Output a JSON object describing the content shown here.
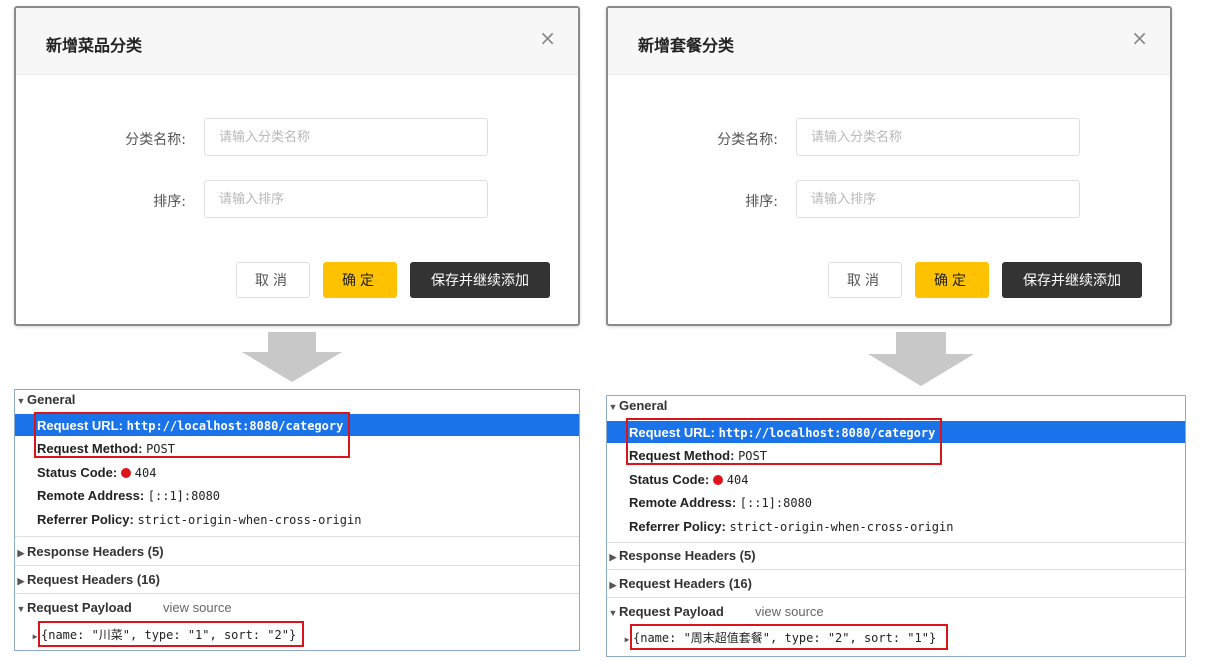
{
  "left": {
    "dialog": {
      "title": "新增菜品分类",
      "close_glyph": "×",
      "name_label": "分类名称:",
      "name_placeholder": "请输入分类名称",
      "sort_label": "排序:",
      "sort_placeholder": "请输入排序",
      "cancel_label": "取消",
      "ok_label": "确定",
      "save_label": "保存并继续添加"
    },
    "devtools": {
      "general_title": "General",
      "request_url_key": "Request URL:",
      "request_url_value": "http://localhost:8080/category",
      "request_method_key": "Request Method:",
      "request_method_value": "POST",
      "status_code_key": "Status Code:",
      "status_code_value": "404",
      "remote_address_key": "Remote Address:",
      "remote_address_value": "[::1]:8080",
      "referrer_policy_key": "Referrer Policy:",
      "referrer_policy_value": "strict-origin-when-cross-origin",
      "response_headers": "Response Headers (5)",
      "request_headers": "Request Headers (16)",
      "request_payload": "Request Payload",
      "view_source": "view source",
      "payload_value": "{name: \"川菜\", type: \"1\", sort: \"2\"}"
    }
  },
  "right": {
    "dialog": {
      "title": "新增套餐分类",
      "close_glyph": "×",
      "name_label": "分类名称:",
      "name_placeholder": "请输入分类名称",
      "sort_label": "排序:",
      "sort_placeholder": "请输入排序",
      "cancel_label": "取消",
      "ok_label": "确定",
      "save_label": "保存并继续添加"
    },
    "devtools": {
      "general_title": "General",
      "request_url_key": "Request URL:",
      "request_url_value": "http://localhost:8080/category",
      "request_method_key": "Request Method:",
      "request_method_value": "POST",
      "status_code_key": "Status Code:",
      "status_code_value": "404",
      "remote_address_key": "Remote Address:",
      "remote_address_value": "[::1]:8080",
      "referrer_policy_key": "Referrer Policy:",
      "referrer_policy_value": "strict-origin-when-cross-origin",
      "response_headers": "Response Headers (5)",
      "request_headers": "Request Headers (16)",
      "request_payload": "Request Payload",
      "view_source": "view source",
      "payload_value": "{name: \"周末超值套餐\", type: \"2\", sort: \"1\"}"
    }
  },
  "colors": {
    "primary_button": "#ffc200",
    "dark_button": "#333333",
    "selected_row": "#1a73e8",
    "highlight_box": "#d9141b",
    "status_dot": "#e0141c"
  }
}
